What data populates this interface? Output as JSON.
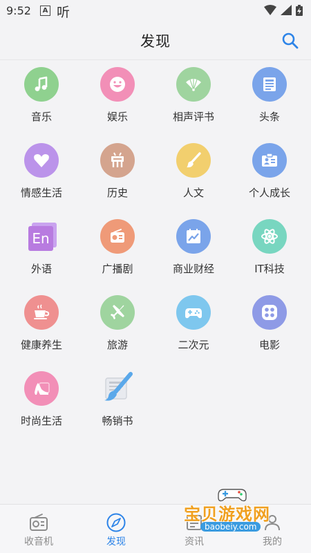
{
  "status_bar": {
    "time": "9:52",
    "notification_a": "A",
    "app_indicator": "听"
  },
  "header": {
    "title": "发现"
  },
  "categories": [
    {
      "label": "音乐",
      "icon": "music-note-icon",
      "color": "#8fd18f"
    },
    {
      "label": "娱乐",
      "icon": "smiley-icon",
      "color": "#f28fb7"
    },
    {
      "label": "相声评书",
      "icon": "folding-fan-icon",
      "color": "#9fd49f"
    },
    {
      "label": "头条",
      "icon": "newspaper-icon",
      "color": "#7aa4ea"
    },
    {
      "label": "情感生活",
      "icon": "heart-icon",
      "color": "#bb93ea"
    },
    {
      "label": "历史",
      "icon": "ancient-vessel-icon",
      "color": "#d4a48e"
    },
    {
      "label": "人文",
      "icon": "paintbrush-icon",
      "color": "#f2cf6e"
    },
    {
      "label": "个人成长",
      "icon": "id-card-icon",
      "color": "#7aa4ea"
    },
    {
      "label": "外语",
      "icon": "english-book-icon",
      "color": "#b87be0",
      "icon_text": "En"
    },
    {
      "label": "广播剧",
      "icon": "radio-icon",
      "color": "#ef9a78"
    },
    {
      "label": "商业财经",
      "icon": "trend-chart-icon",
      "color": "#7aa4ea"
    },
    {
      "label": "IT科技",
      "icon": "atom-icon",
      "color": "#78d6c0"
    },
    {
      "label": "健康养生",
      "icon": "teacup-icon",
      "color": "#ef9090"
    },
    {
      "label": "旅游",
      "icon": "airplane-icon",
      "color": "#9fd49f"
    },
    {
      "label": "二次元",
      "icon": "gamepad-icon",
      "color": "#7ec7ee"
    },
    {
      "label": "电影",
      "icon": "film-reel-icon",
      "color": "#8e9ae6"
    },
    {
      "label": "时尚生活",
      "icon": "high-heel-icon",
      "color": "#f28fb7"
    },
    {
      "label": "畅销书",
      "icon": "bestseller-book-icon",
      "color": "#6ab0e8"
    }
  ],
  "tabs": [
    {
      "label": "收音机",
      "icon": "radio-icon",
      "active": false
    },
    {
      "label": "发现",
      "icon": "compass-icon",
      "active": true
    },
    {
      "label": "资讯",
      "icon": "news-icon",
      "active": false
    },
    {
      "label": "我的",
      "icon": "profile-icon",
      "active": false
    }
  ],
  "watermark": {
    "text": "宝贝游戏网",
    "url": "baobeiy.com"
  },
  "colors": {
    "accent": "#2d84e8",
    "tab_inactive": "#8c8c8c",
    "background": "#f3f3f5"
  }
}
